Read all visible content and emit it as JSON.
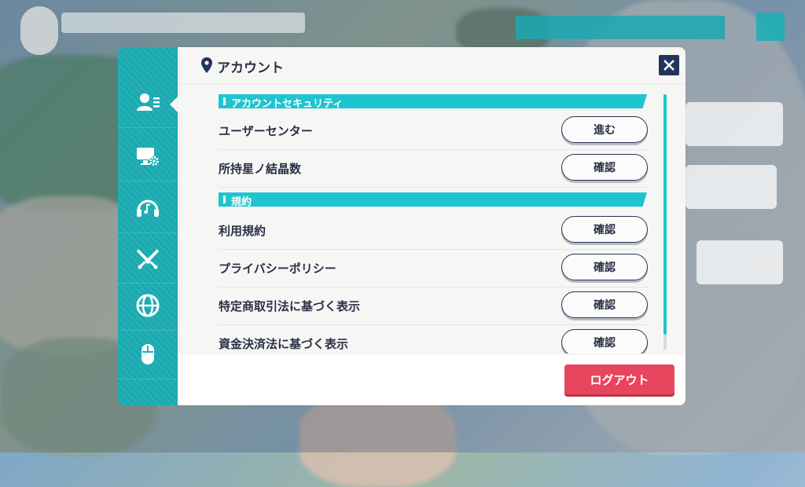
{
  "dialog": {
    "title": "アカウント",
    "close_icon": "close-icon",
    "sections": [
      {
        "header": "アカウントセキュリティ",
        "items": [
          {
            "label": "ユーザーセンター",
            "button": "進む"
          },
          {
            "label": "所持星ノ結晶数",
            "button": "確認"
          }
        ]
      },
      {
        "header": "規約",
        "items": [
          {
            "label": "利用規約",
            "button": "確認"
          },
          {
            "label": "プライバシーポリシー",
            "button": "確認"
          },
          {
            "label": "特定商取引法に基づく表示",
            "button": "確認"
          },
          {
            "label": "資金決済法に基づく表示",
            "button": "確認"
          }
        ]
      }
    ],
    "logout_label": "ログアウト"
  },
  "tabs": [
    {
      "icon": "account-icon",
      "active": true
    },
    {
      "icon": "display-settings-icon"
    },
    {
      "icon": "audio-headphones-icon"
    },
    {
      "icon": "battle-swords-icon"
    },
    {
      "icon": "language-globe-icon"
    },
    {
      "icon": "mouse-icon"
    },
    {
      "icon": "more-icon"
    }
  ],
  "colors": {
    "accent": "#1ec4cf",
    "tab_bg": "#22b1b8",
    "logout": "#e8465f",
    "text": "#2a2f45",
    "close_bg": "#22345a"
  }
}
